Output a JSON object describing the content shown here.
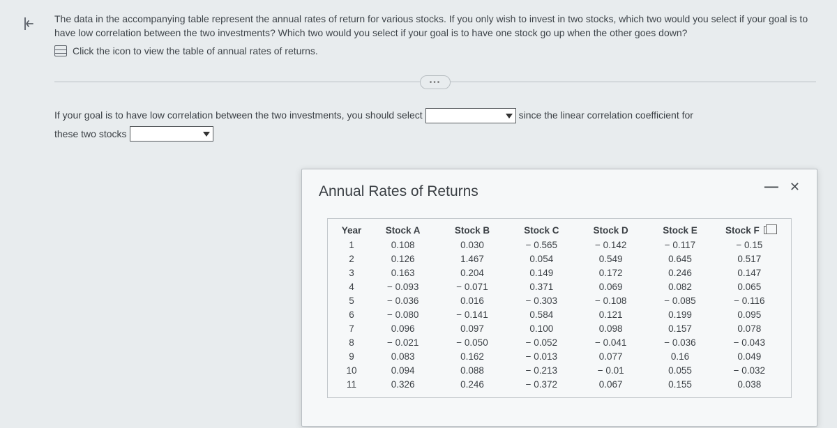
{
  "question": {
    "para": "The data in the accompanying table represent the annual rates of return for various stocks. If you only wish to invest in two stocks, which two would you select if your goal is to have low correlation between the two investments? Which two would you select if your goal is to have one stock go up when the other goes down?",
    "link": "Click the icon to view the table of annual rates of returns."
  },
  "prompt": {
    "seg1": "If your goal is to have low correlation between the two investments, you should select",
    "seg2": "since the linear correlation coefficient for",
    "seg3": "these two stocks"
  },
  "modal": {
    "title": "Annual Rates of Returns",
    "headers": [
      "Year",
      "Stock A",
      "Stock B",
      "Stock C",
      "Stock D",
      "Stock E",
      "Stock F"
    ],
    "rows": [
      [
        "1",
        "0.108",
        "0.030",
        "− 0.565",
        "− 0.142",
        "− 0.117",
        "− 0.15"
      ],
      [
        "2",
        "0.126",
        "1.467",
        "0.054",
        "0.549",
        "0.645",
        "0.517"
      ],
      [
        "3",
        "0.163",
        "0.204",
        "0.149",
        "0.172",
        "0.246",
        "0.147"
      ],
      [
        "4",
        "− 0.093",
        "− 0.071",
        "0.371",
        "0.069",
        "0.082",
        "0.065"
      ],
      [
        "5",
        "− 0.036",
        "0.016",
        "− 0.303",
        "− 0.108",
        "− 0.085",
        "− 0.116"
      ],
      [
        "6",
        "− 0.080",
        "− 0.141",
        "0.584",
        "0.121",
        "0.199",
        "0.095"
      ],
      [
        "7",
        "0.096",
        "0.097",
        "0.100",
        "0.098",
        "0.157",
        "0.078"
      ],
      [
        "8",
        "− 0.021",
        "− 0.050",
        "− 0.052",
        "− 0.041",
        "− 0.036",
        "− 0.043"
      ],
      [
        "9",
        "0.083",
        "0.162",
        "− 0.013",
        "0.077",
        "0.16",
        "0.049"
      ],
      [
        "10",
        "0.094",
        "0.088",
        "− 0.213",
        "− 0.01",
        "0.055",
        "− 0.032"
      ],
      [
        "11",
        "0.326",
        "0.246",
        "− 0.372",
        "0.067",
        "0.155",
        "0.038"
      ]
    ]
  }
}
